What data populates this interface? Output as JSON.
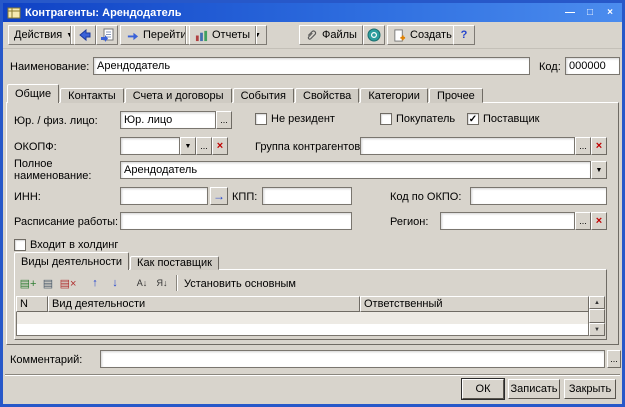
{
  "window": {
    "title": "Контрагенты: Арендодатель"
  },
  "toolbar": {
    "actions": "Действия",
    "go": "Перейти",
    "reports": "Отчеты",
    "files": "Файлы",
    "create": "Создать",
    "help": "?"
  },
  "fields": {
    "name_label": "Наименование:",
    "name_value": "Арендодатель",
    "code_label": "Код:",
    "code_value": "000000",
    "entity_label": "Юр. / физ. лицо:",
    "entity_value": "Юр. лицо",
    "nonresident_label": "Не резидент",
    "nonresident_checked": false,
    "buyer_label": "Покупатель",
    "buyer_checked": false,
    "supplier_label": "Поставщик",
    "supplier_checked": true,
    "okopf_label": "ОКОПФ:",
    "okopf_value": "",
    "group_label": "Группа контрагентов:",
    "group_value": "",
    "fullname_label": "Полное наименование:",
    "fullname_value": "Арендодатель",
    "inn_label": "ИНН:",
    "inn_value": "",
    "kpp_label": "КПП:",
    "kpp_value": "",
    "okpo_label": "Код по ОКПО:",
    "okpo_value": "",
    "schedule_label": "Расписание работы:",
    "schedule_value": "",
    "region_label": "Регион:",
    "region_value": "",
    "holding_label": "Входит в холдинг",
    "holding_checked": false,
    "comment_label": "Комментарий:",
    "comment_value": ""
  },
  "tabs": {
    "active": "Общие",
    "items": [
      {
        "label": "Общие"
      },
      {
        "label": "Контакты"
      },
      {
        "label": "Счета и договоры"
      },
      {
        "label": "События"
      },
      {
        "label": "Свойства"
      },
      {
        "label": "Категории"
      },
      {
        "label": "Прочее"
      }
    ]
  },
  "subtabs": {
    "active": "Виды деятельности",
    "items": [
      {
        "label": "Виды деятельности"
      },
      {
        "label": "Как поставщик"
      }
    ]
  },
  "list_toolbar": {
    "set_primary": "Установить основным"
  },
  "table": {
    "columns": [
      {
        "label": "N"
      },
      {
        "label": "Вид деятельности"
      },
      {
        "label": "Ответственный"
      }
    ],
    "rows": []
  },
  "footer": {
    "ok": "ОК",
    "save": "Записать",
    "close": "Закрыть"
  },
  "icons": {
    "minimize": "—",
    "maximize": "□",
    "close": "×",
    "dropdown": "▼",
    "ellipsis": "...",
    "clear": "×",
    "check": "✓",
    "go_arrow": "→",
    "scroll_up": "▲",
    "scroll_down": "▼",
    "add": "▤+",
    "edit": "▤",
    "delete": "▤×",
    "move_up": "↑",
    "move_down": "↓",
    "sort_asc": "А↓",
    "sort_desc": "Я↓"
  }
}
